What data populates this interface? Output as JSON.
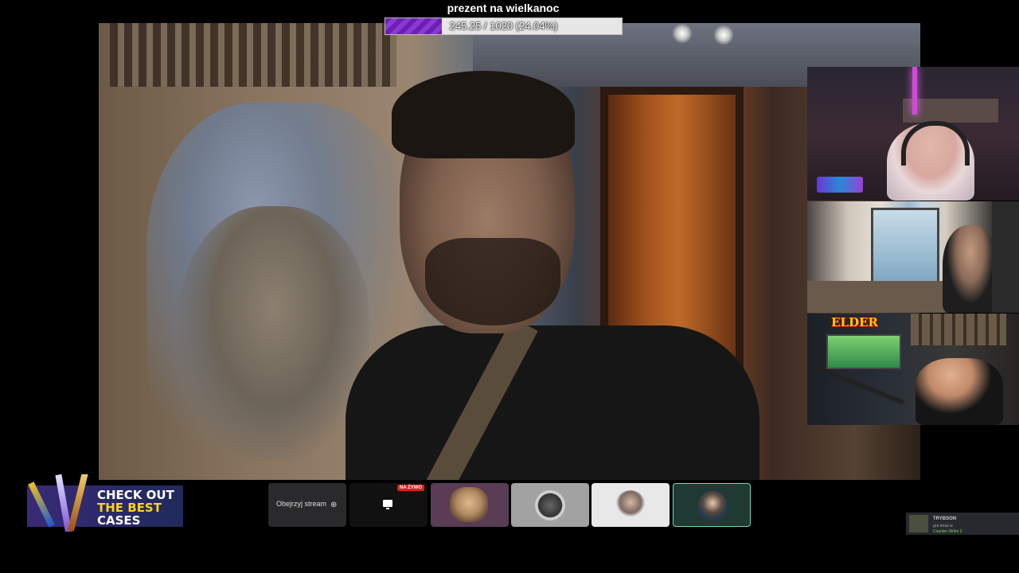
{
  "goal": {
    "title": "prezent na wielkanoc",
    "progress_text": "245.25 / 1020 (24.04%)",
    "progress_fraction": 0.2404,
    "fill_color": "#7a2fc8"
  },
  "promo": {
    "line1": "CHECK OUT",
    "line2": "THE BEST",
    "line3": "CASES"
  },
  "bottom_bar": {
    "watch_label": "Obejrzyj stream",
    "watch_icon": "zoom-in-icon",
    "live_badge": "NA ŻYWO",
    "live_icon": "monitor-icon"
  },
  "notification": {
    "name": "TRYBSON",
    "sub": "gra teraz w",
    "game": "Counter-Strike 2"
  },
  "cams": {
    "cam3_logo": "ELDER"
  }
}
